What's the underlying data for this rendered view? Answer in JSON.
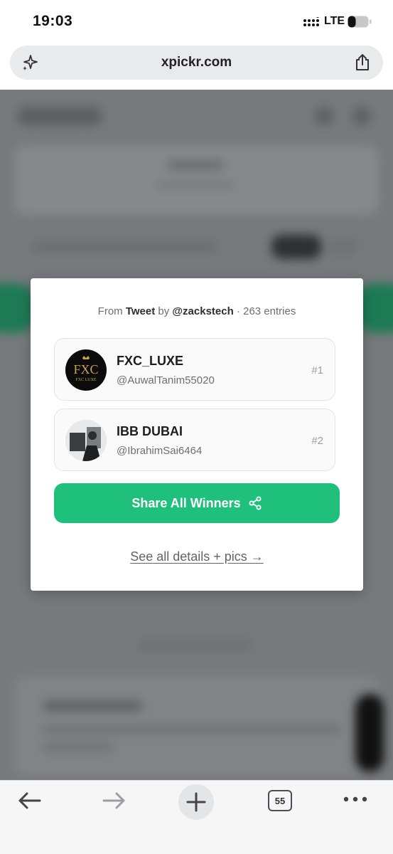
{
  "status_bar": {
    "time": "19:03",
    "network": "LTE"
  },
  "address_bar": {
    "url": "xpickr.com"
  },
  "modal": {
    "source": {
      "prefix": "From",
      "source_name": "Tweet",
      "by": "by",
      "author": "@zackstech",
      "entries": "· 263 entries"
    },
    "winners": [
      {
        "name": "FXC_LUXE",
        "handle": "@AuwalTanim55020",
        "rank": "#1",
        "avatar_text": "FXC",
        "avatar_subtext": "FXC LUXE"
      },
      {
        "name": "IBB DUBAI",
        "handle": "@IbrahimSai6464",
        "rank": "#2"
      }
    ],
    "share_button_label": "Share All Winners",
    "details_link": "See all details + pics →"
  },
  "toolbar": {
    "tab_count": "55"
  },
  "colors": {
    "accent_green": "#1fbf7c",
    "backdrop": "#777a7d"
  },
  "icons": [
    "sparkle-icon",
    "share-page-icon",
    "share-icon",
    "back-icon",
    "forward-icon",
    "plus-icon",
    "more-icon"
  ]
}
